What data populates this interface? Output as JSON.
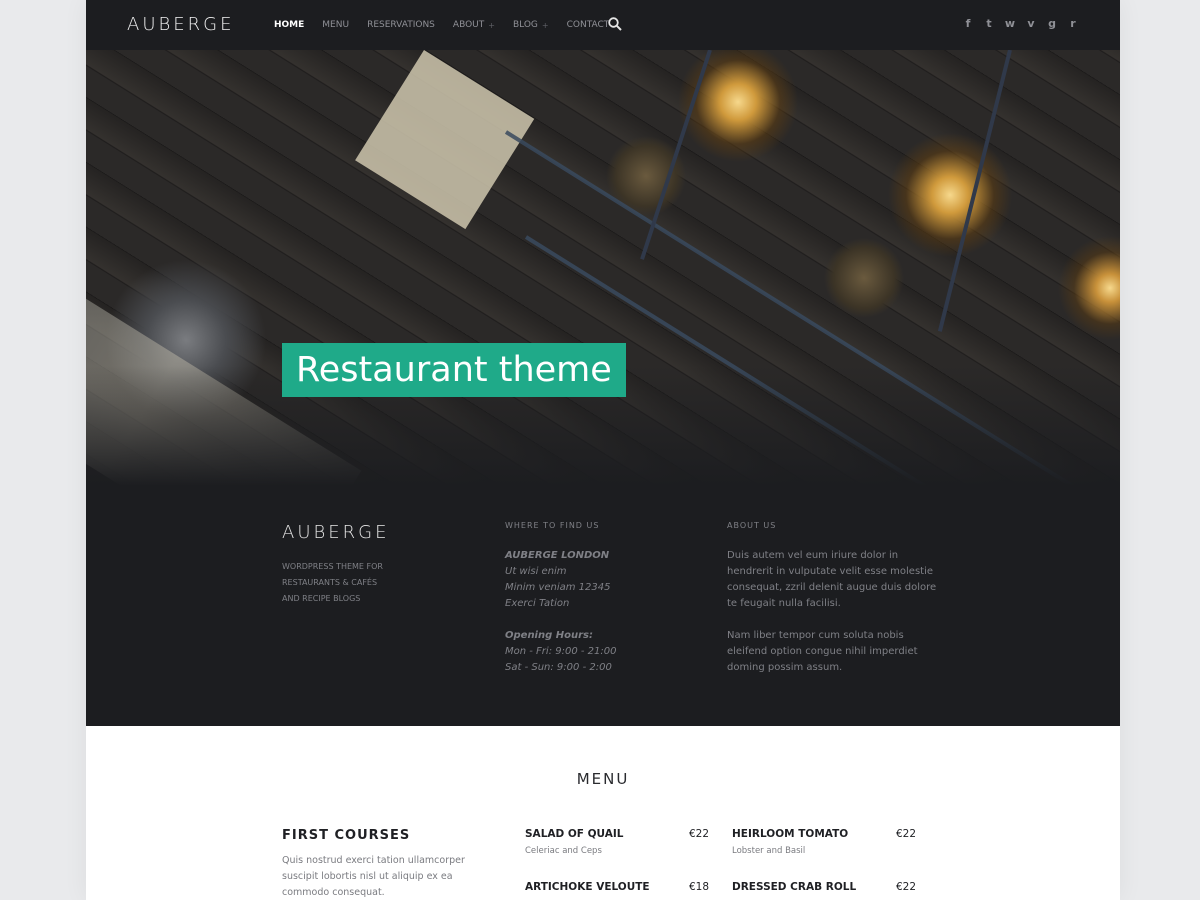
{
  "header": {
    "logo": "AUBERGE",
    "nav": [
      {
        "label": "HOME",
        "has_sub": false,
        "active": true
      },
      {
        "label": "MENU",
        "has_sub": false,
        "active": false
      },
      {
        "label": "RESERVATIONS",
        "has_sub": false,
        "active": false
      },
      {
        "label": "ABOUT",
        "has_sub": true,
        "active": false
      },
      {
        "label": "BLOG",
        "has_sub": true,
        "active": false
      },
      {
        "label": "CONTACT",
        "has_sub": false,
        "active": false
      }
    ],
    "sub_marker": "+",
    "social": [
      "f",
      "t",
      "w",
      "v",
      "g",
      "r"
    ],
    "social_icons": [
      "facebook-icon",
      "twitter-icon",
      "wordpress-icon",
      "vimeo-icon",
      "globe-icon",
      "rss-icon"
    ]
  },
  "hero": {
    "title": "Restaurant theme",
    "accent": "#1faa89"
  },
  "info": {
    "brand": "AUBERGE",
    "tagline": [
      "WORDPRESS THEME FOR",
      "RESTAURANTS & CAFÉS",
      "AND RECIPE BLOGS"
    ],
    "where": {
      "title": "WHERE TO FIND US",
      "address": [
        "AUBERGE LONDON",
        "Ut wisi enim",
        "Minim veniam 12345",
        "Exerci Tation"
      ],
      "hours_title": "Opening Hours:",
      "hours": [
        "Mon - Fri: 9:00 - 21:00",
        "Sat - Sun: 9:00 - 2:00"
      ]
    },
    "about": {
      "title": "ABOUT US",
      "p1": "Duis autem vel eum iriure dolor in hendrerit in vulputate velit esse molestie consequat, zzril delenit augue duis dolore te feugait nulla facilisi.",
      "p2": "Nam liber tempor cum soluta nobis eleifend option congue nihil imperdiet doming possim assum."
    }
  },
  "menu": {
    "title": "MENU",
    "section": "FIRST COURSES",
    "section_desc": "Quis nostrud exerci tation ullamcorper suscipit lobortis nisl ut aliquip ex ea commodo consequat.",
    "dishes": [
      {
        "name": "SALAD OF QUAIL",
        "price": "€22",
        "sub": "Celeriac and Ceps"
      },
      {
        "name": "HEIRLOOM TOMATO",
        "price": "€22",
        "sub": "Lobster and Basil"
      },
      {
        "name": "ARTICHOKE VELOUTE",
        "price": "€18",
        "sub": ""
      },
      {
        "name": "DRESSED CRAB ROLL",
        "price": "€22",
        "sub": ""
      }
    ]
  }
}
